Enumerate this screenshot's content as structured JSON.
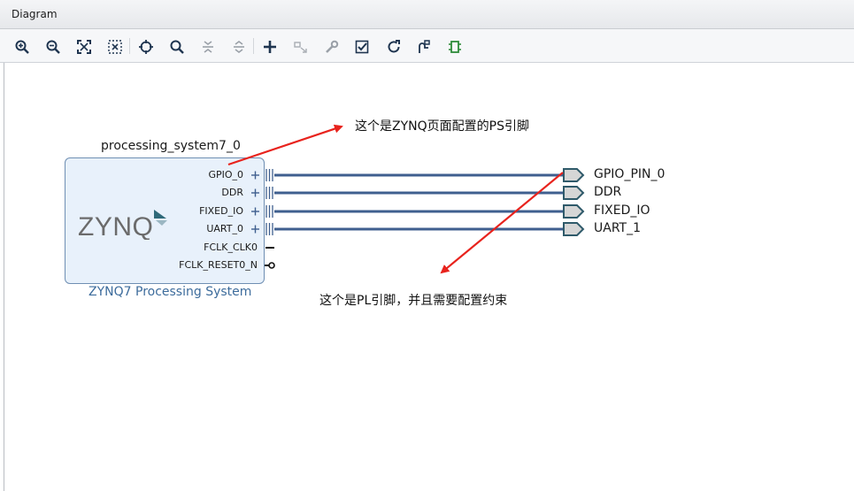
{
  "panel": {
    "title": "Diagram"
  },
  "toolbar": {
    "buttons": [
      {
        "icon": "zoom-in-icon"
      },
      {
        "icon": "zoom-out-icon"
      },
      {
        "icon": "zoom-fit-icon"
      },
      {
        "icon": "fit-selection-icon"
      },
      {
        "icon": "auto-connect-icon"
      },
      {
        "icon": "search-icon"
      },
      {
        "icon": "collapse-all-icon"
      },
      {
        "icon": "expand-all-icon"
      },
      {
        "icon": "add-ip-icon"
      },
      {
        "icon": "make-external-icon"
      },
      {
        "icon": "wrench-icon"
      },
      {
        "icon": "validate-design-icon"
      },
      {
        "icon": "regenerate-layout-icon"
      },
      {
        "icon": "run-automation-icon"
      },
      {
        "icon": "add-module-icon"
      }
    ]
  },
  "block": {
    "instance_name": "processing_system7_0",
    "logo_text": "ZYNQ",
    "display_name": "ZYNQ7 Processing System",
    "ports": [
      {
        "label": "GPIO_0",
        "kind": "bus"
      },
      {
        "label": "DDR",
        "kind": "bus"
      },
      {
        "label": "FIXED_IO",
        "kind": "bus"
      },
      {
        "label": "UART_0",
        "kind": "bus"
      },
      {
        "label": "FCLK_CLK0",
        "kind": "clock"
      },
      {
        "label": "FCLK_RESET0_N",
        "kind": "reset"
      }
    ]
  },
  "external_ports": [
    {
      "label": "GPIO_PIN_0"
    },
    {
      "label": "DDR"
    },
    {
      "label": "FIXED_IO"
    },
    {
      "label": "UART_1"
    }
  ],
  "annotations": {
    "ps_pin_note": "这个是ZYNQ页面配置的PS引脚",
    "pl_pin_note": "这个是PL引脚，并且需要配置约束"
  },
  "colors": {
    "wire": "#3f5f8f",
    "arrow": "#e8231d",
    "port_fill": "#d6d6d6",
    "port_stroke": "#2f5a6a",
    "block_fill": "#e8f1fb",
    "block_stroke": "#6f8fb3"
  }
}
